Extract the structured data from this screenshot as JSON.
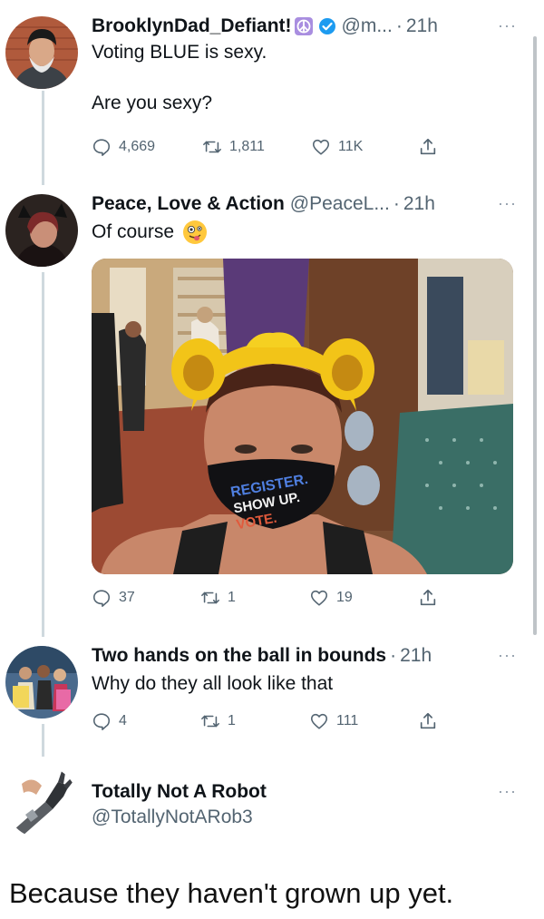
{
  "tweets": [
    {
      "display_name": "BrooklynDad_Defiant!",
      "badge_icon": "peace-sign",
      "verified": true,
      "handle": "@m...",
      "separator": "·",
      "time": "21h",
      "lines": [
        "Voting BLUE is sexy.",
        "Are you sexy?"
      ],
      "reply_count": "4,669",
      "retweet_count": "1,811",
      "like_count": "11K"
    },
    {
      "display_name": "Peace, Love & Action",
      "handle": "@PeaceL...",
      "separator": "·",
      "time": "21h",
      "text": "Of course",
      "emoji": "crazy-face-emoji",
      "mask_text": [
        "REGISTER.",
        "SHOW UP.",
        "VOTE."
      ],
      "reply_count": "37",
      "retweet_count": "1",
      "like_count": "19"
    },
    {
      "display_name": "Two hands on the ball in bounds",
      "separator": "·",
      "time": "21h",
      "text": "Why do they all look like that",
      "reply_count": "4",
      "retweet_count": "1",
      "like_count": "111"
    },
    {
      "display_name": "Totally Not A Robot",
      "handle": "@TotallyNotARob3"
    }
  ],
  "caption": "Because they haven't grown up yet.",
  "colors": {
    "verified": "#1d9bf0",
    "thread_line": "#cfd9de",
    "muted": "#536471"
  }
}
